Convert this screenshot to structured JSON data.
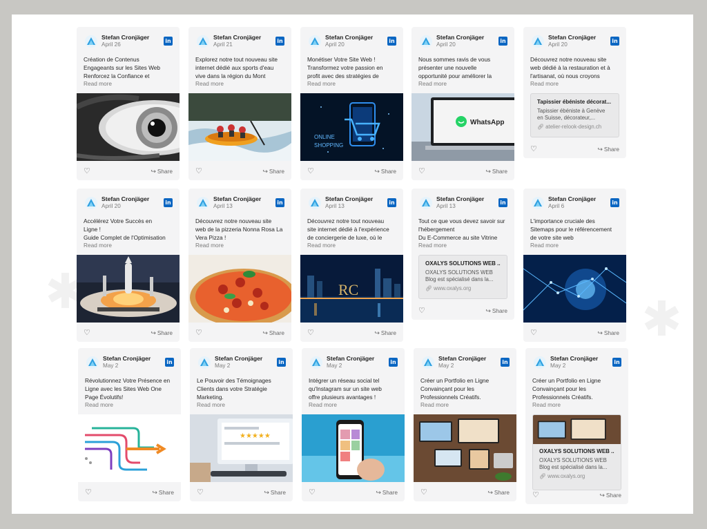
{
  "author": "Stefan Cronjäger",
  "read_more": "Read more",
  "share": "Share",
  "icons": {
    "profile": "oxalys-logo-icon",
    "network": "linkedin-icon",
    "like": "heart-icon",
    "share": "share-arrow-icon",
    "link": "link-icon"
  },
  "colors": {
    "linkedin": "#0a66c2",
    "logo": "#2d9fe0",
    "card": "#f4f4f5"
  },
  "posts": [
    {
      "date": "April 26",
      "lines": [
        "Création de Contenus",
        "Engageants sur les Sites Web",
        "Renforcez la Confiance et"
      ],
      "media": "eye"
    },
    {
      "date": "April 21",
      "lines": [
        "Explorez notre tout nouveau site",
        "internet dédié aux sports d'eau",
        "vive dans la région du Mont"
      ],
      "media": "rafting"
    },
    {
      "date": "April 20",
      "lines": [
        "Monétiser Votre Site Web !",
        "Transformez votre passion en",
        "profit avec des stratégies de"
      ],
      "media": "shopping",
      "overlay": [
        "ONLINE",
        "SHOPPING"
      ]
    },
    {
      "date": "April 20",
      "lines": [
        "Nous sommes ravis de vous",
        "présenter une nouvelle",
        "opportunité pour améliorer la"
      ],
      "media": "whatsapp",
      "overlay": [
        "WhatsApp"
      ]
    },
    {
      "date": "April 20",
      "lines": [
        "Découvrez notre nouveau site",
        "web dédié à la restauration et à",
        "l'artisanat, où nous croyons"
      ],
      "link": {
        "title": "Tapissier ébéniste décorat...",
        "desc": [
          "Tapissier ébéniste à Genève",
          "en Suisse, décorateur,..."
        ],
        "url": "atelier-relook-design.ch"
      }
    },
    {
      "date": "April 20",
      "lines": [
        "Accélérez Votre Succès en",
        "Ligne   !",
        "Guide Complet de l'Optimisation"
      ],
      "media": "rocket"
    },
    {
      "date": "April 13",
      "lines": [
        "Découvrez notre nouveau site",
        "web de la pizzeria Nonna Rosa La",
        "Vera Pizza !"
      ],
      "media": "pizza"
    },
    {
      "date": "April 13",
      "lines": [
        "Découvrez notre tout nouveau",
        "site internet dédié à l'expérience",
        "de conciergerie de luxe, où le"
      ],
      "media": "city"
    },
    {
      "date": "April 13",
      "lines": [
        "Tout ce que vous devez savoir sur",
        "l'hébergement",
        "Du E-Commerce au site Vitrine"
      ],
      "link": {
        "title": "OXALYS SOLUTIONS WEB ...",
        "desc": [
          "OXALYS SOLUTIONS WEB",
          "Blog est spécialisé dans la..."
        ],
        "url": "www.oxalys.org"
      }
    },
    {
      "date": "April 6",
      "lines": [
        "L'importance cruciale des",
        "Sitemaps pour le référencement",
        "de votre site web"
      ],
      "media": "network"
    },
    {
      "date": "May 2",
      "lines": [
        "Révolutionnez Votre Présence en",
        "Ligne avec les Sites Web One",
        "Page Évolutifs!"
      ],
      "media": "arrows"
    },
    {
      "date": "May 2",
      "lines": [
        "Le Pouvoir des Témoignages",
        "Clients dans votre Stratégie",
        "Marketing."
      ],
      "media": "review"
    },
    {
      "date": "May 2",
      "lines": [
        "Intégrer un réseau social tel",
        "qu'Instagram sur un site web",
        "offre plusieurs avantages !"
      ],
      "media": "phone"
    },
    {
      "date": "May 2",
      "lines": [
        "Créer un Portfolio en Ligne",
        "Convainçant pour les",
        "Professionnels Créatifs."
      ],
      "media": "portfolio"
    },
    {
      "date": "May 2",
      "lines": [
        "Créer un Portfolio en Ligne",
        "Convainçant pour les",
        "Professionnels Créatifs."
      ],
      "link": {
        "title": "OXALYS SOLUTIONS WEB ...",
        "desc": [
          "OXALYS SOLUTIONS WEB",
          "Blog est spécialisé dans la..."
        ],
        "url": "www.oxalys.org"
      },
      "link_image": "portfolio"
    }
  ]
}
